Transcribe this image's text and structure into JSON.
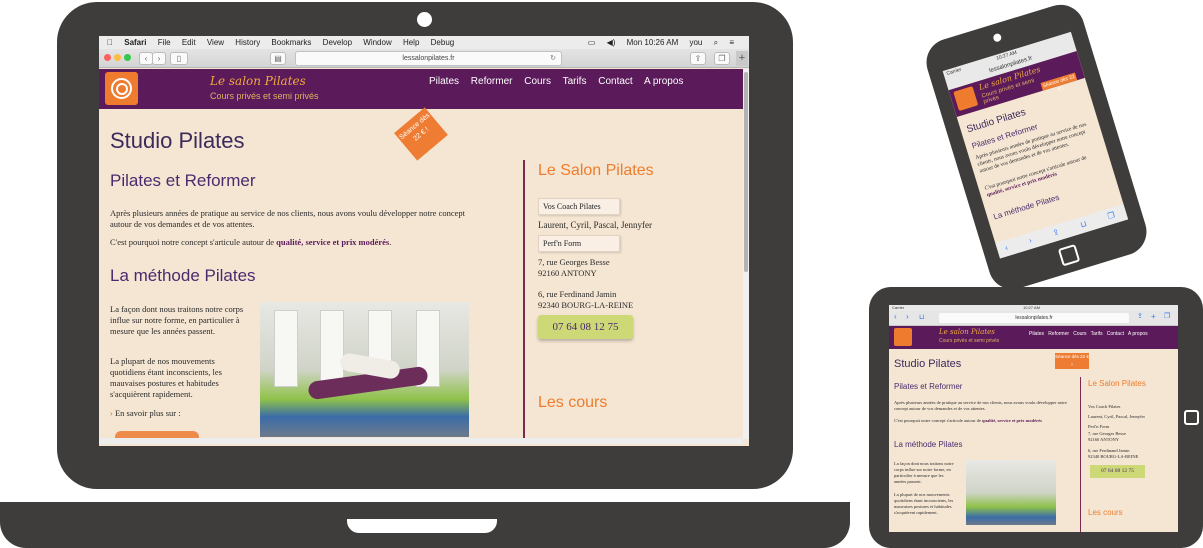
{
  "menubar": {
    "apple": "",
    "items": [
      "Safari",
      "File",
      "Edit",
      "View",
      "History",
      "Bookmarks",
      "Develop",
      "Window",
      "Help",
      "Debug"
    ],
    "clock": "Mon 10:26 AM",
    "user": "you"
  },
  "browser": {
    "url": "lessalonpilates.fr"
  },
  "site": {
    "brand": "Le salon Pilates",
    "tagline": "Cours privés et semi privés",
    "nav": [
      "Pilates",
      "Reformer",
      "Cours",
      "Tarifs",
      "Contact",
      "A propos"
    ],
    "ribbon": "Séance dès 22 € !",
    "title": "Studio Pilates",
    "section1": "Pilates et Reformer",
    "p1": "Après plusieurs années de pratique au service de nos clients, nous avons voulu développer notre concept autour de vos demandes et de vos attentes.",
    "p2_pre": "C'est pourquoi notre concept s'articule autour de ",
    "p2_bold": "qualité, service et prix modérés",
    "p2_post": ".",
    "section2": "La méthode Pilates",
    "m1": "La façon dont nous traitons notre corps influe sur notre forme, en particulier à mesure que les années passent.",
    "m2": "La plupart de nos mouvements quotidiens étant inconscients, les mauvaises postures et habitudes s'acquièrent rapidement.",
    "more": "En savoir plus sur :",
    "side_title": "Le Salon Pilates",
    "coach_tag": "Vos Coach Pilates",
    "coaches": "Laurent, Cyril, Pascal, Jennyfer",
    "form_tag": "Perf'n Form",
    "addr1_l1": "7, rue Georges Besse",
    "addr1_l2": "92160 ANTONY",
    "addr2_l1": "6, rue Ferdinand Jamin",
    "addr2_l2": "92340 BOURG-LA-REINE",
    "phone": "07 64 08 12 75",
    "courses": "Les cours"
  },
  "phone_device": {
    "carrier": "Carrier",
    "time": "10:27 AM",
    "url": "lessalonpilates.fr"
  },
  "tablet_device": {
    "carrier": "Carrier",
    "time": "10:27 AM",
    "url": "lessalonpilates.fr",
    "addr2_l2": "92340 BOURG-LA-REINE",
    "phone": "07 64 08 12 75"
  }
}
